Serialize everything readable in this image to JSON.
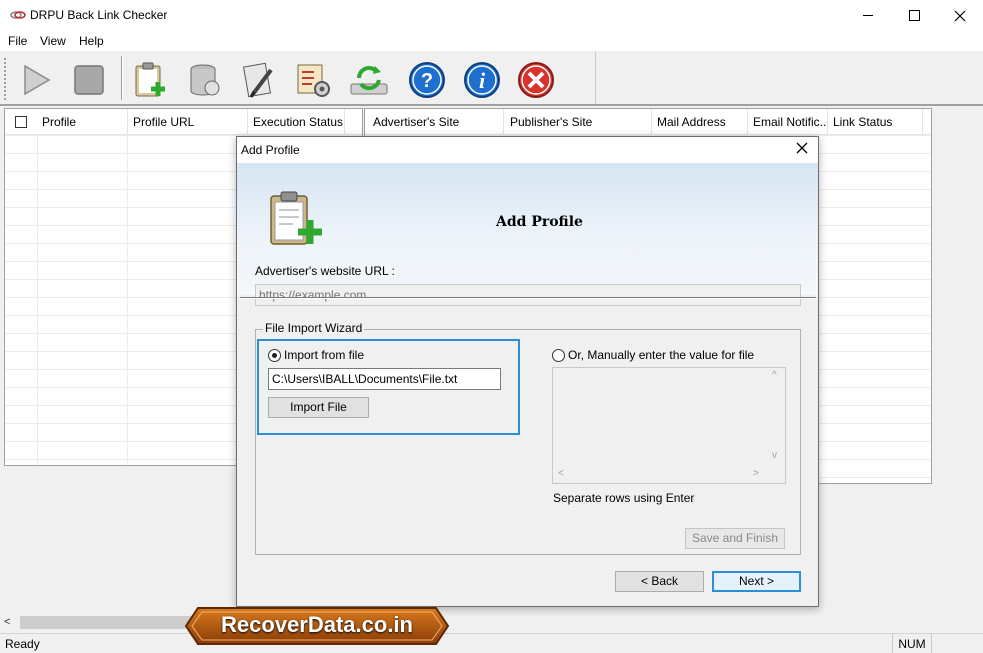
{
  "window": {
    "title": "DRPU Back Link Checker"
  },
  "menu": [
    "File",
    "View",
    "Help"
  ],
  "toolbar": {
    "buttons": [
      {
        "icon": "play-icon"
      },
      {
        "icon": "stop-icon"
      },
      {
        "icon": "add-profile-icon"
      },
      {
        "icon": "database-icon"
      },
      {
        "icon": "edit-report-icon"
      },
      {
        "icon": "settings-checklist-icon"
      },
      {
        "icon": "sync-icon"
      },
      {
        "icon": "help-icon",
        "color": "#1e6fd0"
      },
      {
        "icon": "info-icon",
        "color": "#1e6fd0"
      },
      {
        "icon": "close-icon",
        "color": "#d9342b"
      }
    ]
  },
  "left_grid": {
    "columns": [
      "Profile",
      "Profile URL",
      "Execution Status"
    ]
  },
  "right_grid": {
    "columns": [
      "Advertiser's Site",
      "Publisher's Site",
      "Mail Address",
      "Email Notific...",
      "Link Status"
    ]
  },
  "status": {
    "text": "Ready",
    "num": "NUM"
  },
  "dialog": {
    "title": "Add Profile",
    "header": "Add Profile",
    "url_label": "Advertiser's website URL :",
    "url_placeholder": "https://example.com",
    "group_label": "File Import Wizard",
    "import_radio": "Import from file",
    "file_path": "C:\\Users\\IBALL\\Documents\\File.txt",
    "import_button": "Import File",
    "manual_radio": "Or, Manually enter the value for file",
    "separate_note": "Separate rows using Enter",
    "save_button": "Save and Finish",
    "back_button": "< Back",
    "next_button": "Next >"
  },
  "watermark": "RecoverData.co.in"
}
